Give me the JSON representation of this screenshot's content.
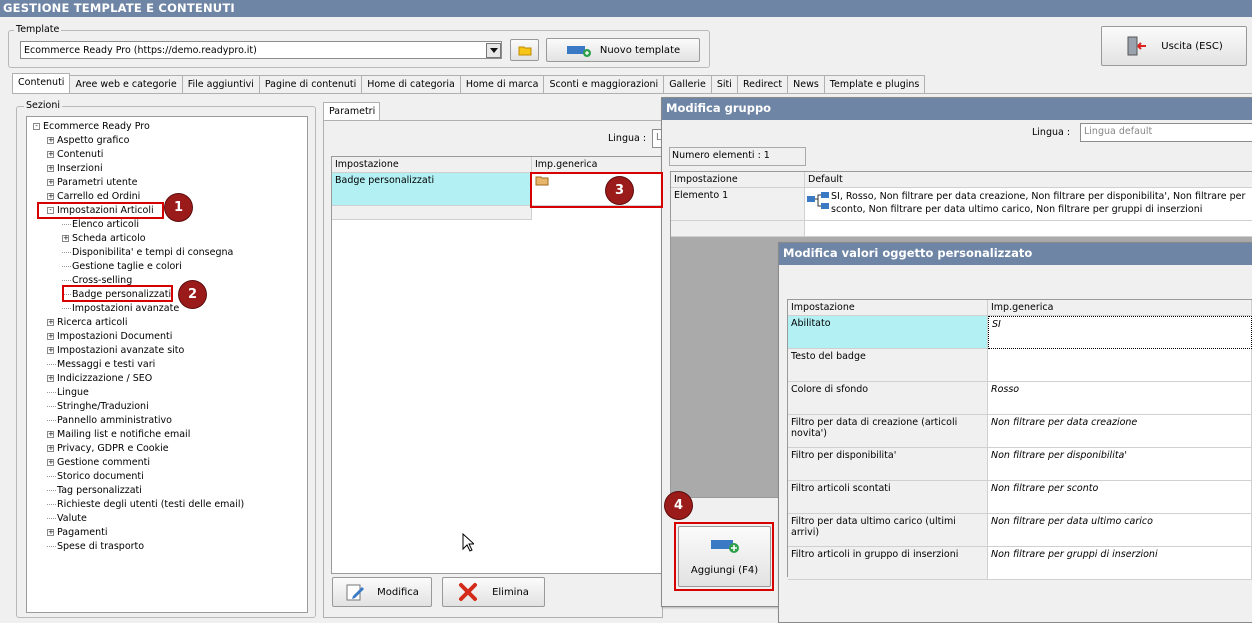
{
  "window_title": "GESTIONE TEMPLATE E CONTENUTI",
  "template": {
    "label": "Template",
    "selected": "Ecommerce Ready Pro (https://demo.readypro.it)",
    "new_button": "Nuovo template"
  },
  "exit_button": "Uscita (ESC)",
  "tabs": [
    "Contenuti",
    "Aree web e categorie",
    "File aggiuntivi",
    "Pagine di contenuti",
    "Home di categoria",
    "Home di marca",
    "Sconti e maggiorazioni",
    "Gallerie",
    "Siti",
    "Redirect",
    "News",
    "Template e plugins"
  ],
  "sections": {
    "label": "Sezioni",
    "root": "Ecommerce Ready Pro",
    "items": [
      {
        "label": "Aspetto grafico",
        "level": 1,
        "expander": "+"
      },
      {
        "label": "Contenuti",
        "level": 1,
        "expander": "+"
      },
      {
        "label": "Inserzioni",
        "level": 1,
        "expander": "+"
      },
      {
        "label": "Parametri utente",
        "level": 1,
        "expander": "+"
      },
      {
        "label": "Carrello ed Ordini",
        "level": 1,
        "expander": "+"
      },
      {
        "label": "Impostazioni Articoli",
        "level": 1,
        "expander": "-"
      },
      {
        "label": "Elenco articoli",
        "level": 2,
        "expander": ""
      },
      {
        "label": "Scheda articolo",
        "level": 2,
        "expander": "+"
      },
      {
        "label": "Disponibilita' e tempi di consegna",
        "level": 2,
        "expander": ""
      },
      {
        "label": "Gestione taglie e colori",
        "level": 2,
        "expander": ""
      },
      {
        "label": "Cross-selling",
        "level": 2,
        "expander": ""
      },
      {
        "label": "Badge personalizzati",
        "level": 2,
        "expander": ""
      },
      {
        "label": "Impostazioni avanzate",
        "level": 2,
        "expander": ""
      },
      {
        "label": "Ricerca articoli",
        "level": 1,
        "expander": "+"
      },
      {
        "label": "Impostazioni Documenti",
        "level": 1,
        "expander": "+"
      },
      {
        "label": "Impostazioni avanzate sito",
        "level": 1,
        "expander": "+"
      },
      {
        "label": "Messaggi e testi vari",
        "level": 1,
        "expander": ""
      },
      {
        "label": "Indicizzazione / SEO",
        "level": 1,
        "expander": "+"
      },
      {
        "label": "Lingue",
        "level": 1,
        "expander": ""
      },
      {
        "label": "Stringhe/Traduzioni",
        "level": 1,
        "expander": ""
      },
      {
        "label": "Pannello amministrativo",
        "level": 1,
        "expander": ""
      },
      {
        "label": "Mailing list e notifiche email",
        "level": 1,
        "expander": "+"
      },
      {
        "label": "Privacy, GDPR e Cookie",
        "level": 1,
        "expander": "+"
      },
      {
        "label": "Gestione commenti",
        "level": 1,
        "expander": "+"
      },
      {
        "label": "Storico documenti",
        "level": 1,
        "expander": ""
      },
      {
        "label": "Tag personalizzati",
        "level": 1,
        "expander": ""
      },
      {
        "label": "Richieste degli utenti (testi delle email)",
        "level": 1,
        "expander": ""
      },
      {
        "label": "Valute",
        "level": 1,
        "expander": ""
      },
      {
        "label": "Pagamenti",
        "level": 1,
        "expander": "+"
      },
      {
        "label": "Spese di trasporto",
        "level": 1,
        "expander": ""
      }
    ]
  },
  "params": {
    "tab": "Parametri",
    "lingua_label": "Lingua :",
    "lingua_value": "L",
    "col_setting": "Impostazione",
    "col_generic": "Imp.generica",
    "row_label": "Badge personalizzati",
    "modify_button": "Modifica",
    "delete_button": "Elimina"
  },
  "group_dialog": {
    "title": "Modifica gruppo",
    "lingua_label": "Lingua :",
    "lingua_placeholder": "Lingua default",
    "count": "Numero elementi : 1",
    "col_setting": "Impostazione",
    "col_default": "Default",
    "element_name": "Elemento 1",
    "element_default": "SI, Rosso, Non filtrare per data creazione, Non filtrare per disponibilita', Non filtrare per sconto, Non filtrare per data ultimo carico, Non filtrare per gruppi di inserzioni",
    "add_button": "Aggiungi (F4)"
  },
  "custom_dialog": {
    "title": "Modifica valori oggetto personalizzato",
    "col_setting": "Impostazione",
    "col_generic": "Imp.generica",
    "rows": [
      {
        "name": "Abilitato",
        "value": "SI"
      },
      {
        "name": "Testo del badge",
        "value": ""
      },
      {
        "name": "Colore di sfondo",
        "value": "Rosso"
      },
      {
        "name": "Filtro per data di creazione (articoli novita')",
        "value": "Non filtrare per data creazione"
      },
      {
        "name": "Filtro per disponibilita'",
        "value": "Non filtrare per disponibilita'"
      },
      {
        "name": "Filtro articoli scontati",
        "value": "Non filtrare per sconto"
      },
      {
        "name": "Filtro per data ultimo carico (ultimi arrivi)",
        "value": "Non filtrare per data ultimo carico"
      },
      {
        "name": "Filtro articoli in gruppo di inserzioni",
        "value": "Non filtrare per gruppi di inserzioni"
      }
    ]
  },
  "markers": [
    "1",
    "2",
    "3",
    "4"
  ],
  "colors": {
    "title_bar": "#6e85a6",
    "highlight": "#b3f0f4",
    "annotation_red": "#d60000",
    "marker": "#9b1b1b"
  }
}
